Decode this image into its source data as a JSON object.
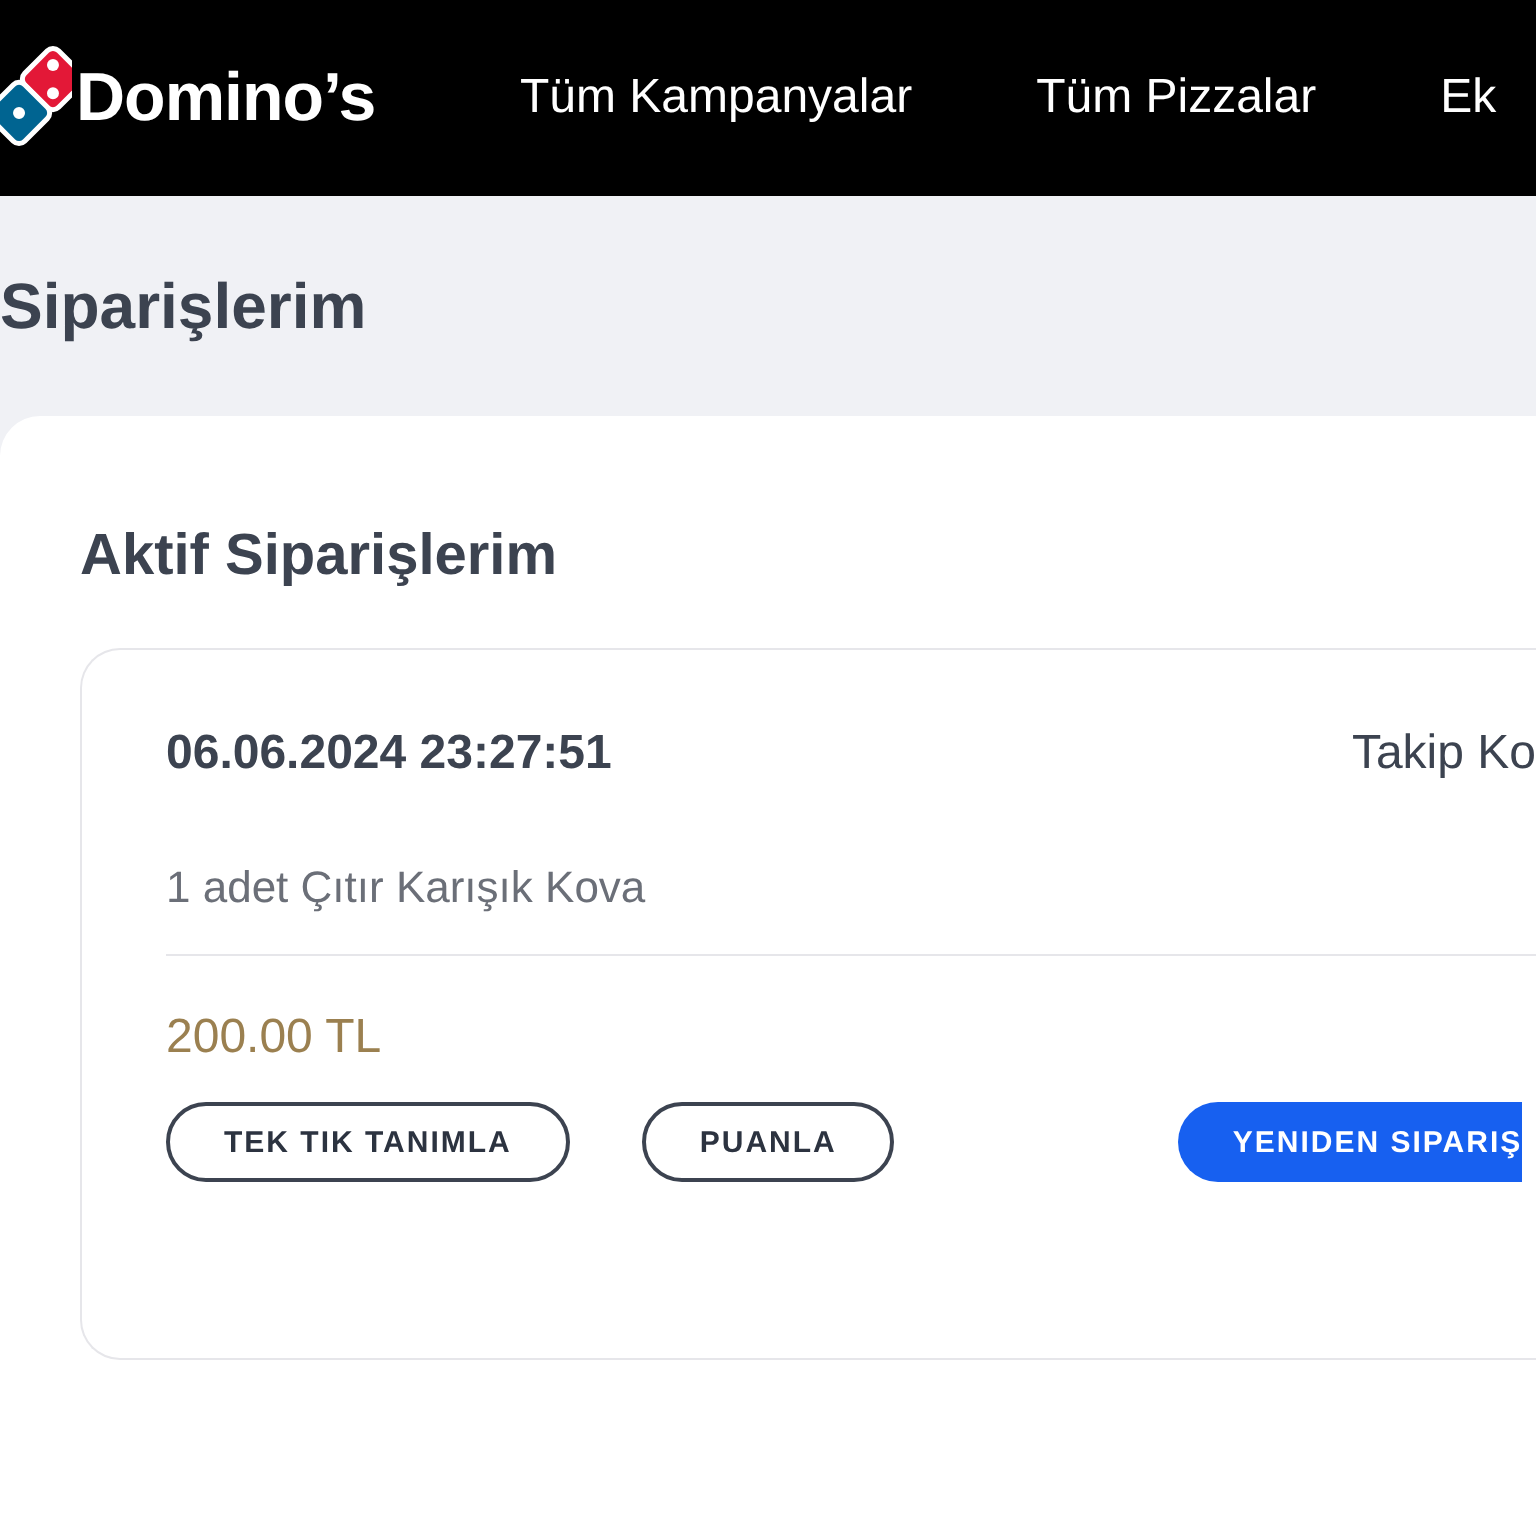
{
  "header": {
    "brand": "Domino’s",
    "nav": [
      "Tüm Kampanyalar",
      "Tüm Pizzalar",
      "Ek"
    ]
  },
  "page_title": "Siparişlerim",
  "section_title": "Aktif Siparişlerim",
  "order": {
    "date": "06.06.2024 23:27:51",
    "tracking": "Takip Ko",
    "item": "1 adet Çıtır Karışık Kova",
    "price": "200.00 TL",
    "buttons": [
      {
        "label": "TEK TIK TANIMLA",
        "kind": "outline"
      },
      {
        "label": "PUANLA",
        "kind": "outline"
      },
      {
        "label": "YENIDEN SIPARIŞ",
        "kind": "primary"
      }
    ]
  }
}
